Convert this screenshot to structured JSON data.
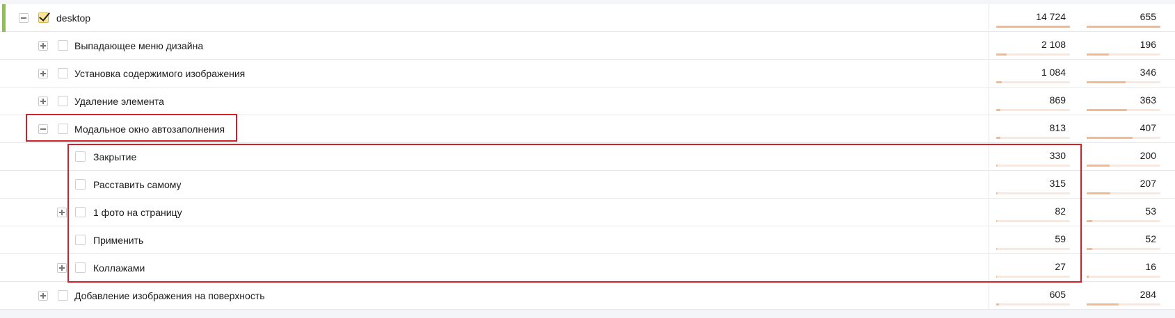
{
  "rows": [
    {
      "label": "desktop",
      "value1": "14 724",
      "value2": "655",
      "fill1": 1.0,
      "fill2": 1.0,
      "level": 0,
      "toggle": "minus",
      "checked": true
    },
    {
      "label": "Выпадающее меню дизайна",
      "value1": "2 108",
      "value2": "196",
      "fill1": 0.14,
      "fill2": 0.3,
      "level": 1,
      "toggle": "plus",
      "checked": false
    },
    {
      "label": "Установка содержимого изображения",
      "value1": "1 084",
      "value2": "346",
      "fill1": 0.074,
      "fill2": 0.53,
      "level": 1,
      "toggle": "plus",
      "checked": false
    },
    {
      "label": "Удаление элемента",
      "value1": "869",
      "value2": "363",
      "fill1": 0.059,
      "fill2": 0.55,
      "level": 1,
      "toggle": "plus",
      "checked": false
    },
    {
      "label": "Модальное окно автозаполнения",
      "value1": "813",
      "value2": "407",
      "fill1": 0.055,
      "fill2": 0.62,
      "level": 1,
      "toggle": "minus",
      "checked": false
    },
    {
      "label": "Закрытие",
      "value1": "330",
      "value2": "200",
      "fill1": 0.022,
      "fill2": 0.31,
      "level": 2,
      "toggle": "",
      "checked": false
    },
    {
      "label": "Расставить самому",
      "value1": "315",
      "value2": "207",
      "fill1": 0.021,
      "fill2": 0.32,
      "level": 2,
      "toggle": "",
      "checked": false
    },
    {
      "label": "1 фото на страницу",
      "value1": "82",
      "value2": "53",
      "fill1": 0.006,
      "fill2": 0.08,
      "level": 2,
      "toggle": "plus",
      "checked": false
    },
    {
      "label": "Применить",
      "value1": "59",
      "value2": "52",
      "fill1": 0.004,
      "fill2": 0.08,
      "level": 2,
      "toggle": "",
      "checked": false
    },
    {
      "label": "Коллажами",
      "value1": "27",
      "value2": "16",
      "fill1": 0.002,
      "fill2": 0.025,
      "level": 2,
      "toggle": "plus",
      "checked": false
    },
    {
      "label": "Добавление изображения на поверхность",
      "value1": "605",
      "value2": "284",
      "fill1": 0.041,
      "fill2": 0.43,
      "level": 1,
      "toggle": "plus",
      "checked": false
    }
  ],
  "colors": {
    "accent_green": "#8bc34a",
    "bar_track": "#fbe8da",
    "bar_fill": "#f5b88c",
    "highlight": "#d0202a"
  }
}
